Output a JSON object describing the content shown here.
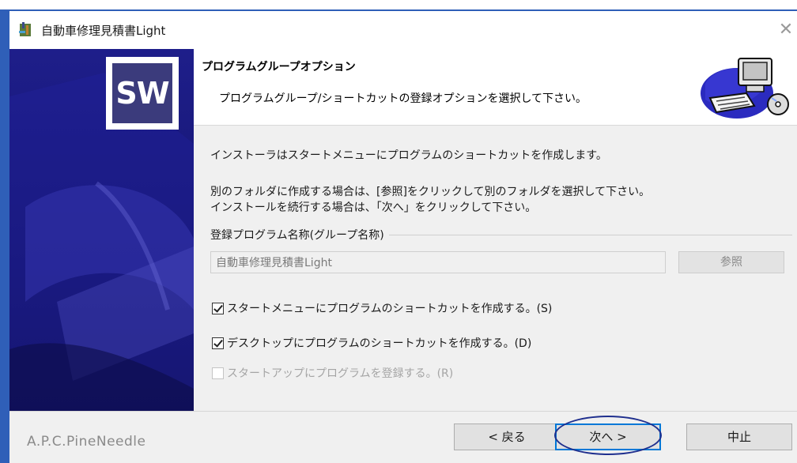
{
  "window": {
    "title": "自動車修理見積書Light",
    "close_symbol": "✕"
  },
  "sidebar": {
    "logo_text": "SW"
  },
  "header": {
    "title": "プログラムグループオプション",
    "subtitle": "プログラムグループ/ショートカットの登録オプションを選択して下さい。"
  },
  "body": {
    "line1": "インストーラはスタートメニューにプログラムのショートカットを作成します。",
    "line2": "別のフォルダに作成する場合は、[参照]をクリックして別のフォルダを選択して下さい。",
    "line3": "インストールを続行する場合は、「次へ」をクリックして下さい。",
    "group_label": "登録プログラム名称(グループ名称)",
    "name_value": "自動車修理見積書Light",
    "browse_label": "参照"
  },
  "options": [
    {
      "label": "スタートメニューにプログラムのショートカットを作成する。(S)",
      "checked": true,
      "enabled": true
    },
    {
      "label": "デスクトップにプログラムのショートカットを作成する。(D)",
      "checked": true,
      "enabled": true
    },
    {
      "label": "スタートアップにプログラムを登録する。(R)",
      "checked": false,
      "enabled": false
    }
  ],
  "footer": {
    "company": "A.P.C.PineNeedle",
    "back_label": "< 戻る",
    "next_label": "次へ >",
    "cancel_label": "中止"
  },
  "colors": {
    "window_border": "#2f5fb8",
    "sidebar": "#1a1a80",
    "focus": "#0078d7",
    "annotation": "#1f2f8e"
  }
}
